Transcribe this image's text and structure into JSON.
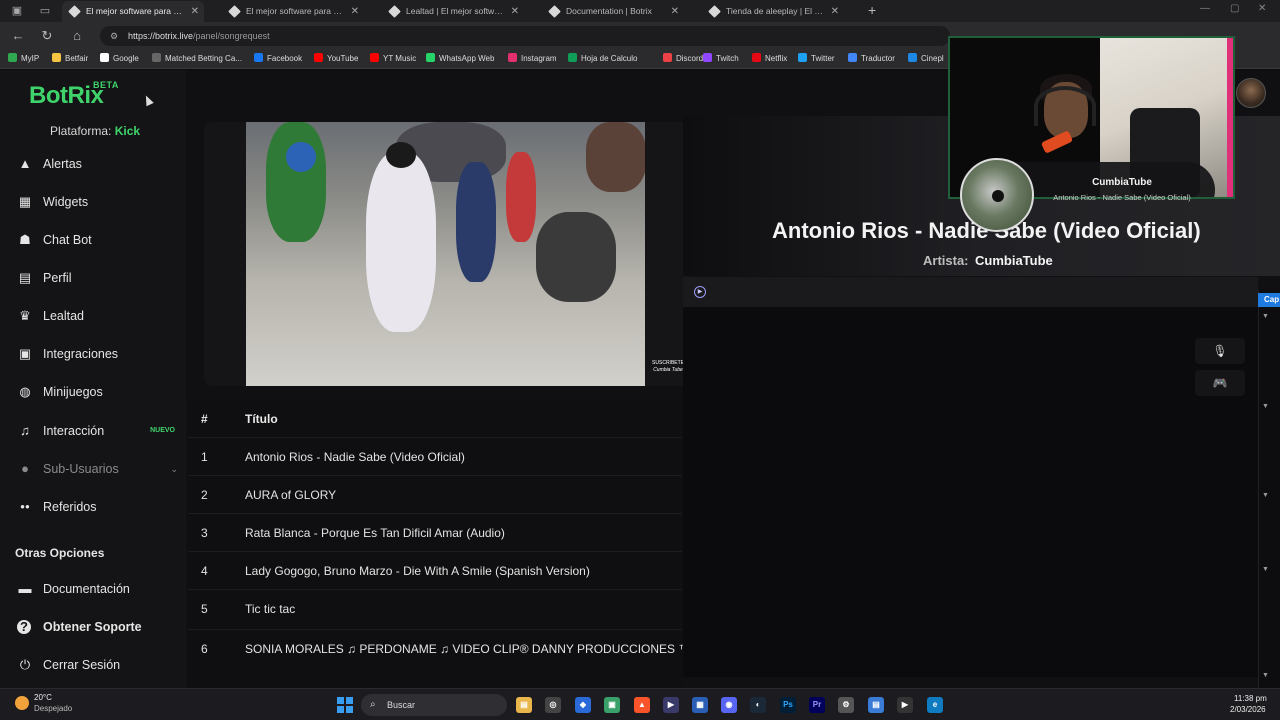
{
  "browser": {
    "tabs": [
      {
        "label": "El mejor software para potenciar"
      },
      {
        "label": "El mejor software para potenciar"
      },
      {
        "label": "Lealtad | El mejor software para p"
      },
      {
        "label": "Documentation | Botrix"
      },
      {
        "label": "Tienda de aleeplay | El mejor soft"
      }
    ],
    "url_host": "https://botrix.live",
    "url_path": "/panel/songrequest",
    "bookmarks": [
      {
        "label": "MyIP",
        "color": "#2fa84f"
      },
      {
        "label": "Betfair",
        "color": "#f6c343"
      },
      {
        "label": "Google",
        "color": "#ffffff"
      },
      {
        "label": "Matched Betting Ca...",
        "color": "#666666"
      },
      {
        "label": "Facebook",
        "color": "#1877f2"
      },
      {
        "label": "YouTube",
        "color": "#ff0000"
      },
      {
        "label": "YT Music",
        "color": "#ff0000"
      },
      {
        "label": "WhatsApp Web",
        "color": "#25d366"
      },
      {
        "label": "Instagram",
        "color": "#e1306c"
      },
      {
        "label": "Hoja de Calculo",
        "color": "#0f9d58"
      },
      {
        "label": "Discord",
        "color": "#ed4245"
      },
      {
        "label": "Twitch",
        "color": "#9146ff"
      },
      {
        "label": "Netflix",
        "color": "#e50914"
      },
      {
        "label": "Twitter",
        "color": "#1da1f2"
      },
      {
        "label": "Traductor",
        "color": "#4285f4"
      },
      {
        "label": "Cinepl",
        "color": "#1e88e5"
      }
    ]
  },
  "sidebar": {
    "logo": "BotRix",
    "logo_badge": "BETA",
    "platform_label": "Plataforma:",
    "platform_value": "Kick",
    "items": [
      {
        "label": "Alertas",
        "icon": "warning-icon"
      },
      {
        "label": "Widgets",
        "icon": "grid-icon"
      },
      {
        "label": "Chat Bot",
        "icon": "robot-icon"
      },
      {
        "label": "Perfil",
        "icon": "id-card-icon"
      },
      {
        "label": "Lealtad",
        "icon": "trophy-icon"
      },
      {
        "label": "Integraciones",
        "icon": "integrations-icon"
      },
      {
        "label": "Minijuegos",
        "icon": "gamepad-icon"
      },
      {
        "label": "Interacción",
        "icon": "music-note-icon",
        "badge": "NUEVO"
      },
      {
        "label": "Sub-Usuarios",
        "icon": "user-icon"
      },
      {
        "label": "Referidos",
        "icon": "users-icon"
      }
    ],
    "section_title": "Otras Opciones",
    "other_items": [
      {
        "label": "Documentación",
        "icon": "book-icon"
      },
      {
        "label": "Obtener Soporte",
        "icon": "question-icon"
      },
      {
        "label": "Cerrar Sesión",
        "icon": "power-icon"
      }
    ]
  },
  "video": {
    "watermark_line1": "SUSCRIBETE",
    "watermark_line2": "Cumbia Tube"
  },
  "song_table": {
    "headers": {
      "num": "#",
      "title": "Título"
    },
    "rows": [
      {
        "num": "1",
        "title": "Antonio Rios - Nadie Sabe (Video Oficial)"
      },
      {
        "num": "2",
        "title": "AURA of GLORY"
      },
      {
        "num": "3",
        "title": "Rata Blanca - Porque Es Tan Dificil Amar (Audio)"
      },
      {
        "num": "4",
        "title": "Lady Gogogo, Bruno Marzo - Die With A Smile (Spanish Version)"
      },
      {
        "num": "5",
        "title": "Tic tic tac"
      },
      {
        "num": "6",
        "title": "SONIA MORALES ♫ PERDONAME ♫ VIDEO CLIP® DANNY PRODUCCIONES ™✓"
      }
    ]
  },
  "now_playing": {
    "title": "Antonio Rios - Nadie Sabe (Video Oficial)",
    "artist_label": "Artista:",
    "artist": "CumbiaTube",
    "card_artist": "CumbiaTube",
    "card_title": "Antonio Rios - Nadie Sabe (Video Oficial)"
  },
  "right_panel": {
    "cap_label": "Cap"
  },
  "taskbar": {
    "temp": "20°C",
    "weather": "Despejado",
    "search_placeholder": "Buscar",
    "time": "11:38 pm",
    "date": "2/03/2026"
  }
}
